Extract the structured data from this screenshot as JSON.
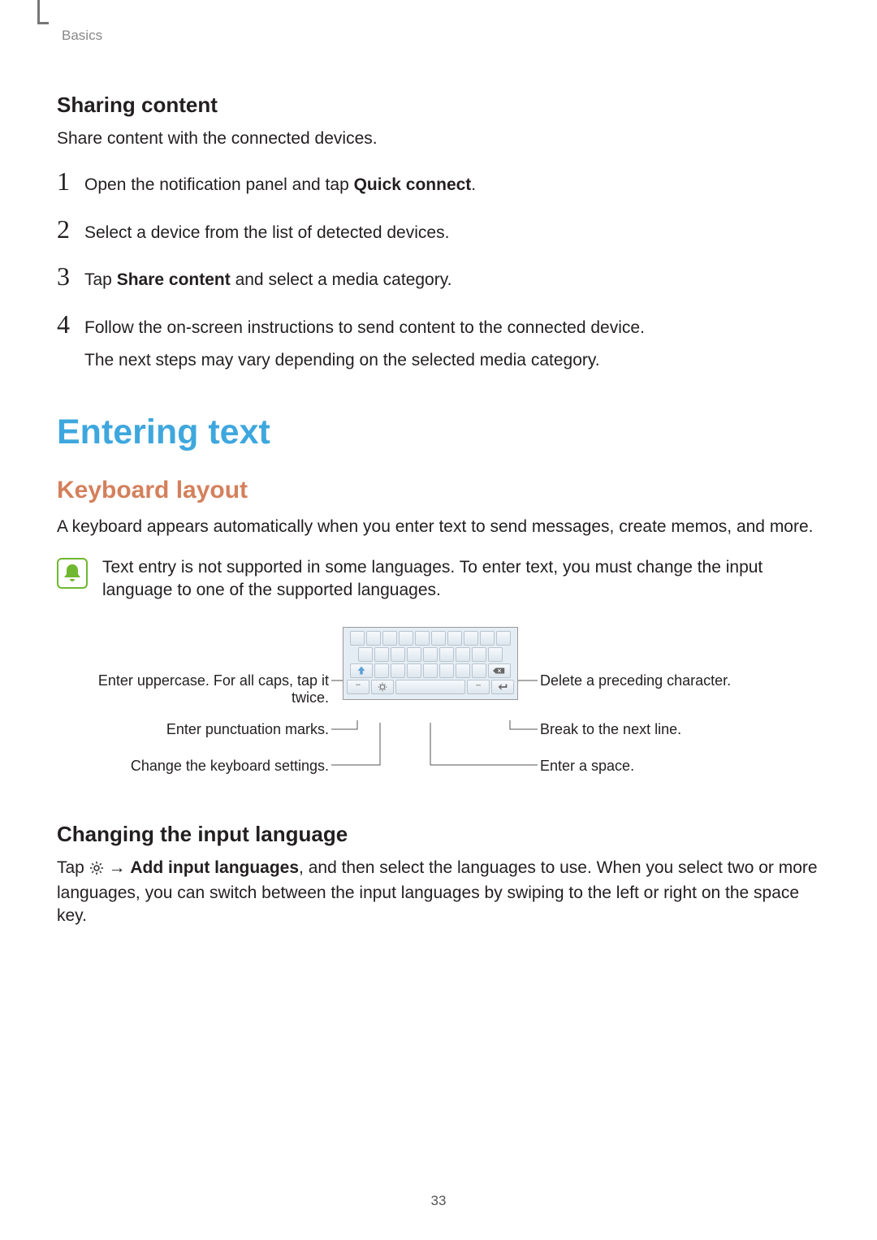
{
  "breadcrumb": "Basics",
  "sharing": {
    "heading": "Sharing content",
    "intro": "Share content with the connected devices.",
    "steps": {
      "s1_pre": "Open the notification panel and tap ",
      "s1_bold": "Quick connect",
      "s1_post": ".",
      "s2": "Select a device from the list of detected devices.",
      "s3_pre": "Tap ",
      "s3_bold": "Share content",
      "s3_post": " and select a media category.",
      "s4a": "Follow the on-screen instructions to send content to the connected device.",
      "s4b": "The next steps may vary depending on the selected media category."
    },
    "nums": {
      "n1": "1",
      "n2": "2",
      "n3": "3",
      "n4": "4"
    }
  },
  "entering": {
    "h1": "Entering text",
    "h2": "Keyboard layout",
    "intro": "A keyboard appears automatically when you enter text to send messages, create memos, and more.",
    "note": "Text entry is not supported in some languages. To enter text, you must change the input language to one of the supported languages."
  },
  "callouts": {
    "shift": "Enter uppercase. For all caps, tap it twice.",
    "sym": "Enter punctuation marks.",
    "gear": "Change the keyboard settings.",
    "delete": "Delete a preceding character.",
    "enter": "Break to the next line.",
    "space": "Enter a space."
  },
  "changing": {
    "heading": "Changing the input language",
    "pre": "Tap ",
    "arrow": " → ",
    "bold": "Add input languages",
    "post": ", and then select the languages to use. When you select two or more languages, you can switch between the input languages by swiping to the left or right on the space key."
  },
  "pagenum": "33"
}
